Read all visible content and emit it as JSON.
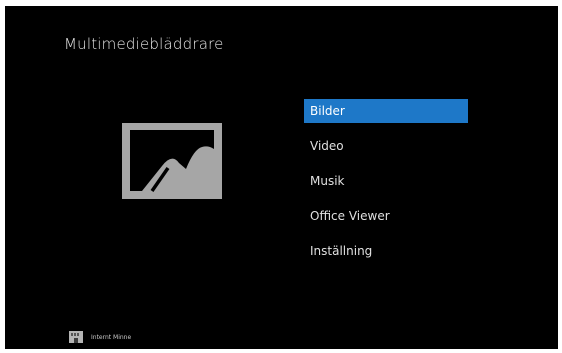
{
  "app": {
    "title": "Multimediebläddrare"
  },
  "preview": {
    "icon": "image-placeholder-icon"
  },
  "menu": {
    "items": [
      {
        "label": "Bilder",
        "selected": true
      },
      {
        "label": "Video",
        "selected": false
      },
      {
        "label": "Musik",
        "selected": false
      },
      {
        "label": "Office Viewer",
        "selected": false
      },
      {
        "label": "Inställning",
        "selected": false
      }
    ]
  },
  "storage": {
    "icon": "memory-card-icon",
    "label": "Internt Minne"
  },
  "colors": {
    "background": "#000000",
    "selection": "#1e78c8",
    "text": "#e0e0e0"
  }
}
